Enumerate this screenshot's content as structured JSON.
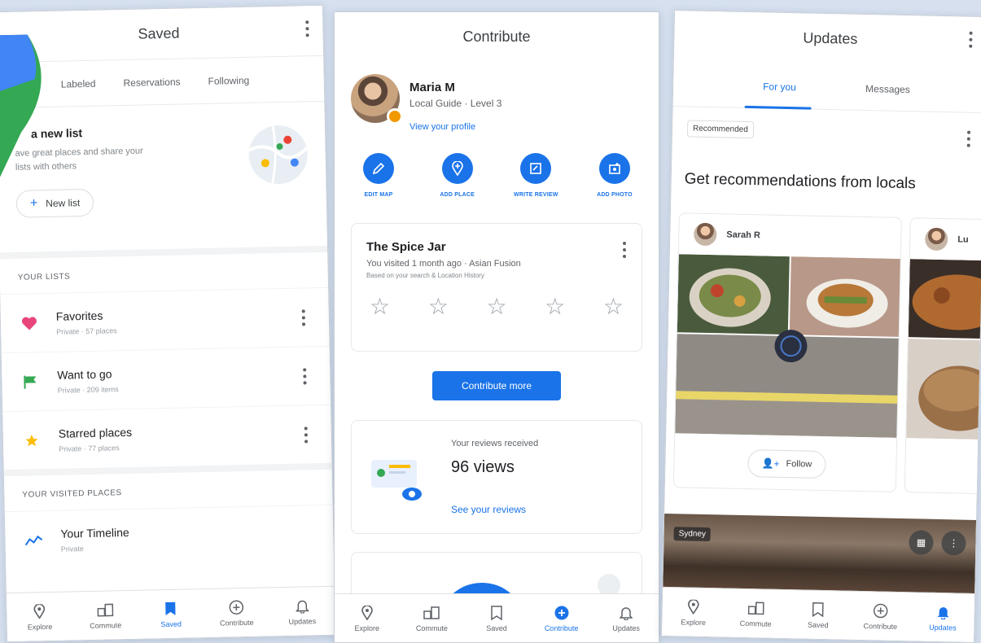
{
  "saved": {
    "title": "Saved",
    "tabs": [
      "Labeled",
      "Reservations",
      "Following"
    ],
    "new_list": {
      "title": "a new list",
      "subtitle": "ave great places and share your lists with others",
      "button_label": "New list"
    },
    "your_lists_label": "YOUR LISTS",
    "lists": [
      {
        "name": "Favorites",
        "meta": "Private · 57 places",
        "icon": "heart-icon",
        "color": "#e8457a"
      },
      {
        "name": "Want to go",
        "meta": "Private · 209 items",
        "icon": "flag-icon",
        "color": "#34a853"
      },
      {
        "name": "Starred places",
        "meta": "Private · 77 places",
        "icon": "star-icon",
        "color": "#fbbc04"
      }
    ],
    "visited_label": "YOUR VISITED PLACES",
    "timeline": {
      "name": "Your Timeline",
      "meta": "Private",
      "icon": "timeline-icon"
    }
  },
  "contribute": {
    "title": "Contribute",
    "profile": {
      "name": "Maria M",
      "level": "Local Guide · Level 3",
      "link": "View your profile"
    },
    "actions": [
      {
        "label": "EDIT MAP",
        "icon": "pencil-icon"
      },
      {
        "label": "ADD PLACE",
        "icon": "add-place-icon"
      },
      {
        "label": "WRITE REVIEW",
        "icon": "review-icon"
      },
      {
        "label": "ADD PHOTO",
        "icon": "add-photo-icon"
      }
    ],
    "place_card": {
      "name": "The Spice Jar",
      "visited": "You visited 1 month ago · Asian Fusion",
      "basis": "Based on your search & Location History"
    },
    "contribute_more": "Contribute more",
    "reviews": {
      "label": "Your reviews received",
      "count": "96 views",
      "link": "See your reviews"
    }
  },
  "updates": {
    "title": "Updates",
    "tabs": {
      "for_you": "For you",
      "messages": "Messages"
    },
    "badge": "Recommended",
    "heading": "Get recommendations from locals",
    "locals": [
      {
        "name": "Sarah R",
        "follow": "Follow"
      },
      {
        "name": "Lu"
      }
    ],
    "sydney_tag": "Sydney"
  },
  "nav": {
    "items": [
      "Explore",
      "Commute",
      "Saved",
      "Contribute",
      "Updates"
    ]
  },
  "colors": {
    "accent": "#1a73e8",
    "background": "#d6e0ef"
  }
}
